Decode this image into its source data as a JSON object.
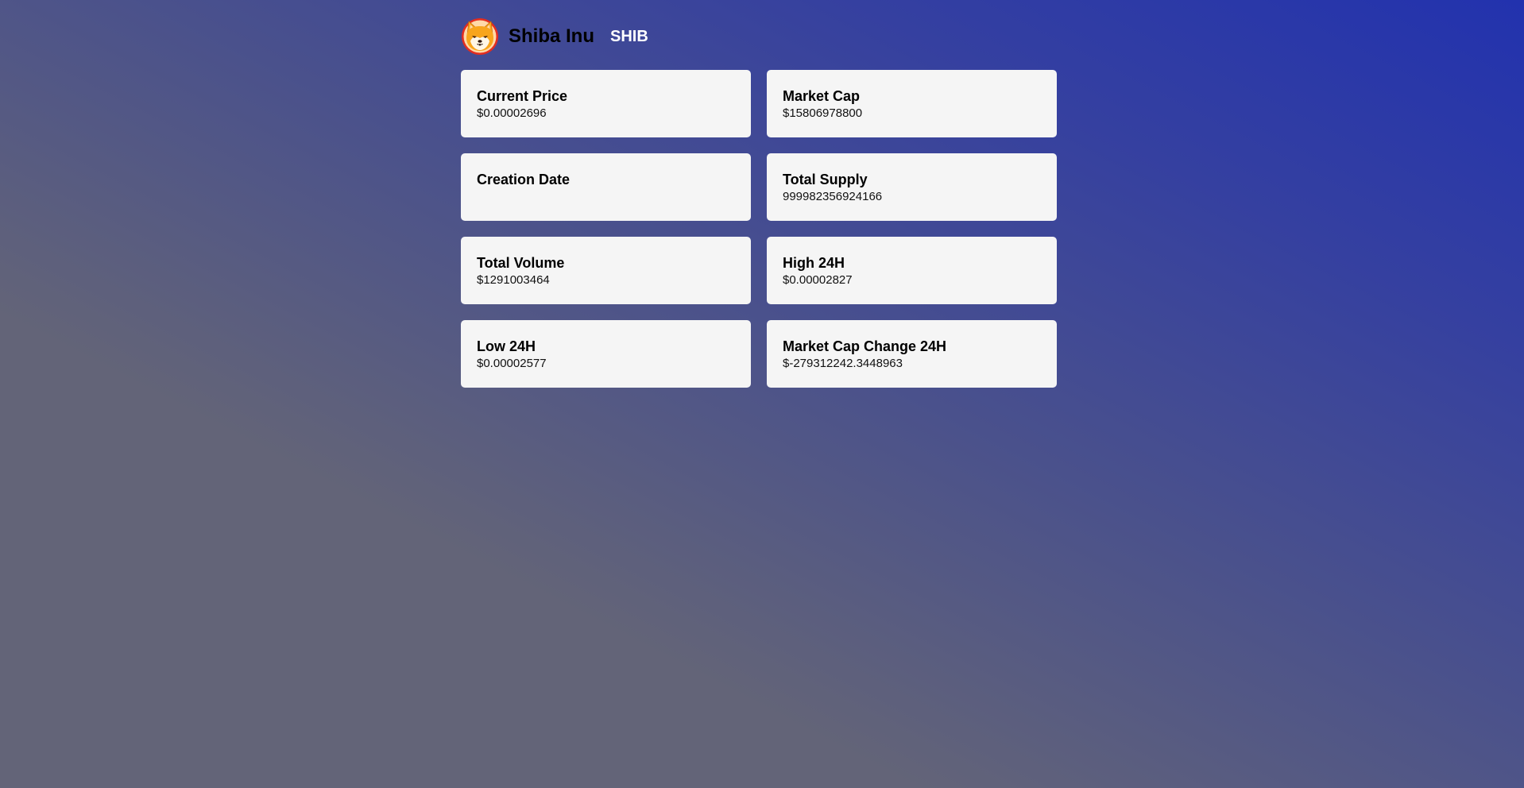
{
  "coin": {
    "name": "Shiba Inu",
    "symbol": "SHIB",
    "logo_icon": "shiba-inu-logo-icon"
  },
  "stats": [
    {
      "label": "Current Price",
      "value": "$0.00002696"
    },
    {
      "label": "Market Cap",
      "value": "$15806978800"
    },
    {
      "label": "Creation Date",
      "value": ""
    },
    {
      "label": "Total Supply",
      "value": "999982356924166"
    },
    {
      "label": "Total Volume",
      "value": "$1291003464"
    },
    {
      "label": "High 24H",
      "value": "$0.00002827"
    },
    {
      "label": "Low 24H",
      "value": "$0.00002577"
    },
    {
      "label": "Market Cap Change 24H",
      "value": "$-279312242.3448963"
    }
  ],
  "colors": {
    "card_background": "#f5f5f5",
    "symbol_text": "#ffffff",
    "logo_ring": "#e42d1f",
    "logo_fur": "#f8a51c"
  }
}
